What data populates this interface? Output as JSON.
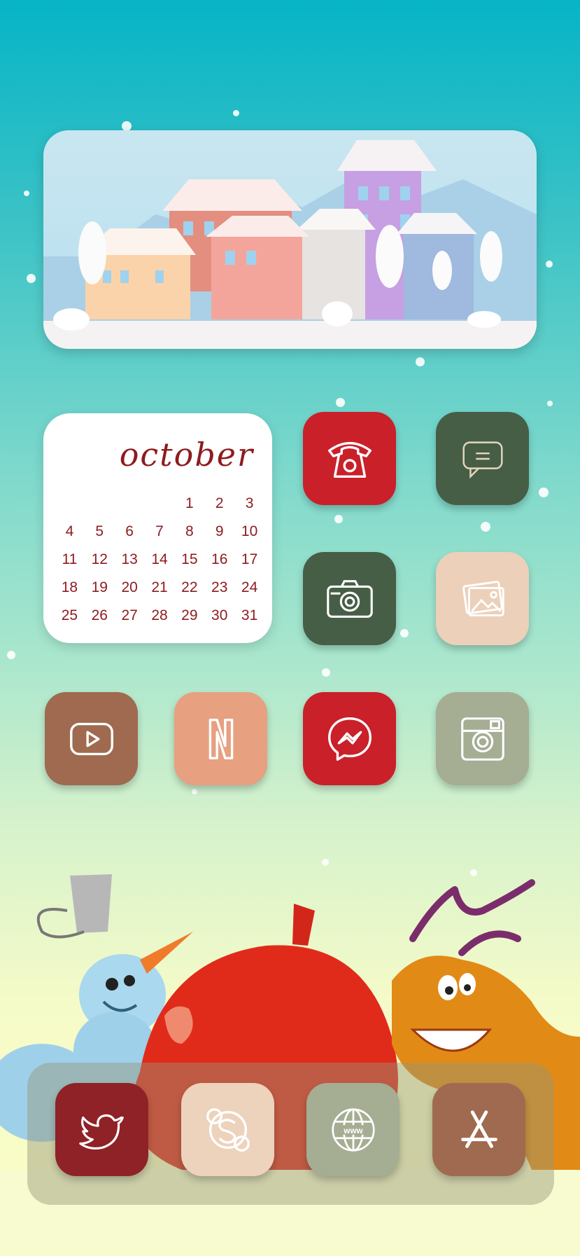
{
  "calendar": {
    "month": "october",
    "days": [
      [
        "",
        "",
        "",
        "",
        "1",
        "2",
        "3"
      ],
      [
        "4",
        "5",
        "6",
        "7",
        "8",
        "9",
        "10"
      ],
      [
        "11",
        "12",
        "13",
        "14",
        "15",
        "16",
        "17"
      ],
      [
        "18",
        "19",
        "20",
        "21",
        "22",
        "23",
        "24"
      ],
      [
        "25",
        "26",
        "27",
        "28",
        "29",
        "30",
        "31"
      ]
    ]
  },
  "apps": [
    {
      "name": "phone",
      "icon": "telephone-icon",
      "color": "#c9202a"
    },
    {
      "name": "messages",
      "icon": "chat-bubble-icon",
      "color": "#465e45"
    },
    {
      "name": "camera",
      "icon": "camera-icon",
      "color": "#465e45"
    },
    {
      "name": "photos",
      "icon": "photos-icon",
      "color": "#ecd0b9"
    },
    {
      "name": "youtube",
      "icon": "play-icon",
      "color": "#9f6a50"
    },
    {
      "name": "netflix",
      "icon": "netflix-n-icon",
      "color": "#e7a080"
    },
    {
      "name": "messenger",
      "icon": "messenger-icon",
      "color": "#c9202a"
    },
    {
      "name": "instagram",
      "icon": "instagram-camera-icon",
      "color": "#a5ad93"
    }
  ],
  "dock": [
    {
      "name": "twitter",
      "icon": "bird-icon",
      "color": "#8f2227"
    },
    {
      "name": "skype",
      "icon": "skype-icon",
      "color": "#edd2bc"
    },
    {
      "name": "safari",
      "icon": "globe-www-icon",
      "color": "#a5ad93"
    },
    {
      "name": "app-store",
      "icon": "app-store-icon",
      "color": "#9f6a50"
    }
  ],
  "globe_label": "www"
}
